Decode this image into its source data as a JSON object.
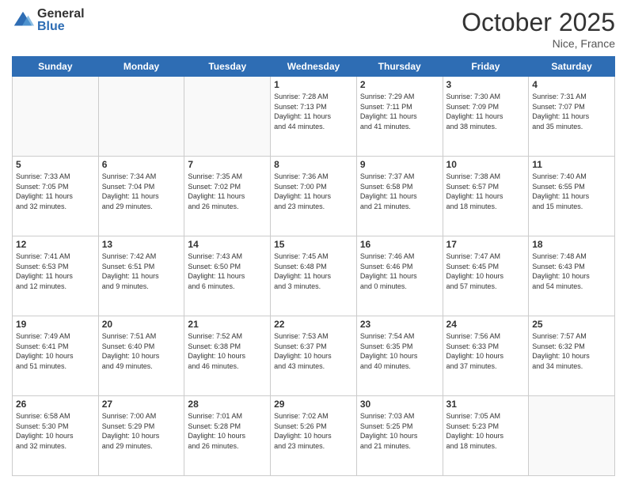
{
  "header": {
    "logo_general": "General",
    "logo_blue": "Blue",
    "month_title": "October 2025",
    "location": "Nice, France"
  },
  "weekdays": [
    "Sunday",
    "Monday",
    "Tuesday",
    "Wednesday",
    "Thursday",
    "Friday",
    "Saturday"
  ],
  "weeks": [
    [
      {
        "day": "",
        "info": ""
      },
      {
        "day": "",
        "info": ""
      },
      {
        "day": "",
        "info": ""
      },
      {
        "day": "1",
        "info": "Sunrise: 7:28 AM\nSunset: 7:13 PM\nDaylight: 11 hours\nand 44 minutes."
      },
      {
        "day": "2",
        "info": "Sunrise: 7:29 AM\nSunset: 7:11 PM\nDaylight: 11 hours\nand 41 minutes."
      },
      {
        "day": "3",
        "info": "Sunrise: 7:30 AM\nSunset: 7:09 PM\nDaylight: 11 hours\nand 38 minutes."
      },
      {
        "day": "4",
        "info": "Sunrise: 7:31 AM\nSunset: 7:07 PM\nDaylight: 11 hours\nand 35 minutes."
      }
    ],
    [
      {
        "day": "5",
        "info": "Sunrise: 7:33 AM\nSunset: 7:05 PM\nDaylight: 11 hours\nand 32 minutes."
      },
      {
        "day": "6",
        "info": "Sunrise: 7:34 AM\nSunset: 7:04 PM\nDaylight: 11 hours\nand 29 minutes."
      },
      {
        "day": "7",
        "info": "Sunrise: 7:35 AM\nSunset: 7:02 PM\nDaylight: 11 hours\nand 26 minutes."
      },
      {
        "day": "8",
        "info": "Sunrise: 7:36 AM\nSunset: 7:00 PM\nDaylight: 11 hours\nand 23 minutes."
      },
      {
        "day": "9",
        "info": "Sunrise: 7:37 AM\nSunset: 6:58 PM\nDaylight: 11 hours\nand 21 minutes."
      },
      {
        "day": "10",
        "info": "Sunrise: 7:38 AM\nSunset: 6:57 PM\nDaylight: 11 hours\nand 18 minutes."
      },
      {
        "day": "11",
        "info": "Sunrise: 7:40 AM\nSunset: 6:55 PM\nDaylight: 11 hours\nand 15 minutes."
      }
    ],
    [
      {
        "day": "12",
        "info": "Sunrise: 7:41 AM\nSunset: 6:53 PM\nDaylight: 11 hours\nand 12 minutes."
      },
      {
        "day": "13",
        "info": "Sunrise: 7:42 AM\nSunset: 6:51 PM\nDaylight: 11 hours\nand 9 minutes."
      },
      {
        "day": "14",
        "info": "Sunrise: 7:43 AM\nSunset: 6:50 PM\nDaylight: 11 hours\nand 6 minutes."
      },
      {
        "day": "15",
        "info": "Sunrise: 7:45 AM\nSunset: 6:48 PM\nDaylight: 11 hours\nand 3 minutes."
      },
      {
        "day": "16",
        "info": "Sunrise: 7:46 AM\nSunset: 6:46 PM\nDaylight: 11 hours\nand 0 minutes."
      },
      {
        "day": "17",
        "info": "Sunrise: 7:47 AM\nSunset: 6:45 PM\nDaylight: 10 hours\nand 57 minutes."
      },
      {
        "day": "18",
        "info": "Sunrise: 7:48 AM\nSunset: 6:43 PM\nDaylight: 10 hours\nand 54 minutes."
      }
    ],
    [
      {
        "day": "19",
        "info": "Sunrise: 7:49 AM\nSunset: 6:41 PM\nDaylight: 10 hours\nand 51 minutes."
      },
      {
        "day": "20",
        "info": "Sunrise: 7:51 AM\nSunset: 6:40 PM\nDaylight: 10 hours\nand 49 minutes."
      },
      {
        "day": "21",
        "info": "Sunrise: 7:52 AM\nSunset: 6:38 PM\nDaylight: 10 hours\nand 46 minutes."
      },
      {
        "day": "22",
        "info": "Sunrise: 7:53 AM\nSunset: 6:37 PM\nDaylight: 10 hours\nand 43 minutes."
      },
      {
        "day": "23",
        "info": "Sunrise: 7:54 AM\nSunset: 6:35 PM\nDaylight: 10 hours\nand 40 minutes."
      },
      {
        "day": "24",
        "info": "Sunrise: 7:56 AM\nSunset: 6:33 PM\nDaylight: 10 hours\nand 37 minutes."
      },
      {
        "day": "25",
        "info": "Sunrise: 7:57 AM\nSunset: 6:32 PM\nDaylight: 10 hours\nand 34 minutes."
      }
    ],
    [
      {
        "day": "26",
        "info": "Sunrise: 6:58 AM\nSunset: 5:30 PM\nDaylight: 10 hours\nand 32 minutes."
      },
      {
        "day": "27",
        "info": "Sunrise: 7:00 AM\nSunset: 5:29 PM\nDaylight: 10 hours\nand 29 minutes."
      },
      {
        "day": "28",
        "info": "Sunrise: 7:01 AM\nSunset: 5:28 PM\nDaylight: 10 hours\nand 26 minutes."
      },
      {
        "day": "29",
        "info": "Sunrise: 7:02 AM\nSunset: 5:26 PM\nDaylight: 10 hours\nand 23 minutes."
      },
      {
        "day": "30",
        "info": "Sunrise: 7:03 AM\nSunset: 5:25 PM\nDaylight: 10 hours\nand 21 minutes."
      },
      {
        "day": "31",
        "info": "Sunrise: 7:05 AM\nSunset: 5:23 PM\nDaylight: 10 hours\nand 18 minutes."
      },
      {
        "day": "",
        "info": ""
      }
    ]
  ]
}
